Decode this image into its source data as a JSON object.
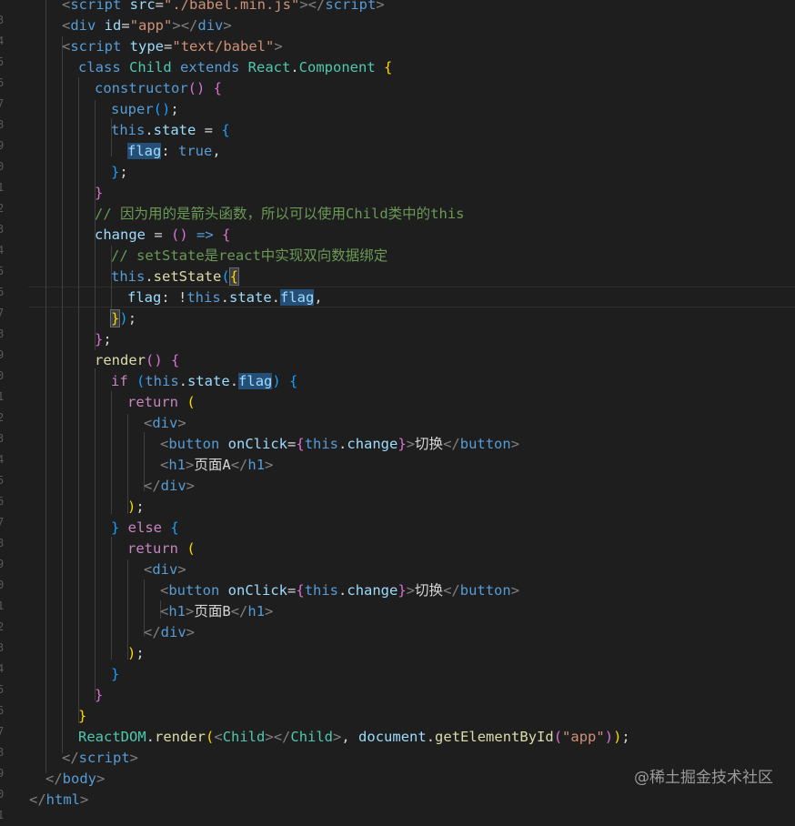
{
  "editor": {
    "gutter_fragments": [
      "3",
      "4",
      "5",
      "6",
      "7",
      "8",
      "9",
      "0",
      "1",
      "2",
      "3",
      "4",
      "5",
      "6",
      "7",
      "8",
      "9",
      "0",
      "1",
      "2",
      "3",
      "4",
      "5",
      "6",
      "7",
      "8",
      "9",
      "0",
      "1",
      "2",
      "3",
      "4",
      "5",
      "6",
      "7",
      "8",
      "9",
      "0",
      "1"
    ],
    "lines": [
      {
        "indent": 68,
        "segs": [
          [
            "tag",
            "<"
          ],
          [
            "tagname",
            "script"
          ],
          [
            "attr",
            " src"
          ],
          [
            "txt",
            "="
          ],
          [
            "str",
            "\"./babel.min.js\""
          ],
          [
            "tag",
            "></"
          ],
          [
            "tagname",
            "script"
          ],
          [
            "tag",
            ">"
          ]
        ]
      },
      {
        "indent": 68,
        "segs": [
          [
            "tag",
            "<"
          ],
          [
            "tagname",
            "div"
          ],
          [
            "attr",
            " id"
          ],
          [
            "txt",
            "="
          ],
          [
            "str",
            "\"app\""
          ],
          [
            "tag",
            "></"
          ],
          [
            "tagname",
            "div"
          ],
          [
            "tag",
            ">"
          ]
        ]
      },
      {
        "indent": 68,
        "segs": [
          [
            "tag",
            "<"
          ],
          [
            "tagname",
            "script"
          ],
          [
            "attr",
            " type"
          ],
          [
            "txt",
            "="
          ],
          [
            "str",
            "\"text/babel\""
          ],
          [
            "tag",
            ">"
          ]
        ]
      },
      {
        "indent": 86,
        "segs": [
          [
            "kw",
            "class "
          ],
          [
            "cls",
            "Child "
          ],
          [
            "kw",
            "extends "
          ],
          [
            "cls",
            "React"
          ],
          [
            "txt",
            "."
          ],
          [
            "cls",
            "Component "
          ],
          [
            "br1",
            "{"
          ]
        ]
      },
      {
        "indent": 104,
        "segs": [
          [
            "kw",
            "constructor"
          ],
          [
            "br2",
            "()"
          ],
          [
            "txt",
            " "
          ],
          [
            "br2",
            "{"
          ]
        ]
      },
      {
        "indent": 122,
        "segs": [
          [
            "kw",
            "super"
          ],
          [
            "br3",
            "()"
          ],
          [
            "txt",
            ";"
          ]
        ]
      },
      {
        "indent": 122,
        "segs": [
          [
            "kw",
            "this"
          ],
          [
            "txt",
            "."
          ],
          [
            "prop",
            "state"
          ],
          [
            "txt",
            " = "
          ],
          [
            "br3",
            "{"
          ]
        ]
      },
      {
        "indent": 140,
        "segs": [
          [
            "hl:prop",
            "flag"
          ],
          [
            "txt",
            ": "
          ],
          [
            "kw",
            "true"
          ],
          [
            "txt",
            ","
          ]
        ]
      },
      {
        "indent": 122,
        "segs": [
          [
            "br3",
            "}"
          ],
          [
            "txt",
            ";"
          ]
        ]
      },
      {
        "indent": 104,
        "segs": [
          [
            "br2",
            "}"
          ]
        ]
      },
      {
        "indent": 104,
        "segs": [
          [
            "cmt",
            "// 因为用的是箭头函数，所以可以使用Child类中的this"
          ]
        ]
      },
      {
        "indent": 104,
        "segs": [
          [
            "var",
            "change"
          ],
          [
            "txt",
            " = "
          ],
          [
            "br2",
            "()"
          ],
          [
            "txt",
            " "
          ],
          [
            "kw",
            "=>"
          ],
          [
            "txt",
            " "
          ],
          [
            "br2",
            "{"
          ]
        ]
      },
      {
        "indent": 122,
        "segs": [
          [
            "cmt",
            "// setState是react中实现双向数据绑定"
          ]
        ]
      },
      {
        "indent": 122,
        "segs": [
          [
            "kw",
            "this"
          ],
          [
            "txt",
            "."
          ],
          [
            "fn",
            "setState"
          ],
          [
            "br3",
            "("
          ],
          [
            "hl2:br1",
            "{"
          ]
        ]
      },
      {
        "indent": 140,
        "segs": [
          [
            "prop",
            "flag"
          ],
          [
            "txt",
            ": !"
          ],
          [
            "kw",
            "this"
          ],
          [
            "txt",
            "."
          ],
          [
            "prop",
            "state"
          ],
          [
            "txt",
            "."
          ],
          [
            "hl:prop",
            "flag"
          ],
          [
            "txt",
            ","
          ]
        ]
      },
      {
        "indent": 122,
        "segs": [
          [
            "hl2:br1",
            "}"
          ],
          [
            "br3",
            ")"
          ],
          [
            "txt",
            ";"
          ]
        ]
      },
      {
        "indent": 104,
        "segs": [
          [
            "br2",
            "}"
          ],
          [
            "txt",
            ";"
          ]
        ]
      },
      {
        "indent": 104,
        "segs": [
          [
            "fn",
            "render"
          ],
          [
            "br2",
            "()"
          ],
          [
            "txt",
            " "
          ],
          [
            "br2",
            "{"
          ]
        ]
      },
      {
        "indent": 122,
        "segs": [
          [
            "ctrl",
            "if "
          ],
          [
            "br3",
            "("
          ],
          [
            "kw",
            "this"
          ],
          [
            "txt",
            "."
          ],
          [
            "prop",
            "state"
          ],
          [
            "txt",
            "."
          ],
          [
            "hl:prop",
            "flag"
          ],
          [
            "br3",
            ")"
          ],
          [
            "txt",
            " "
          ],
          [
            "br3",
            "{"
          ]
        ]
      },
      {
        "indent": 140,
        "segs": [
          [
            "ctrl",
            "return "
          ],
          [
            "br1",
            "("
          ]
        ]
      },
      {
        "indent": 158,
        "segs": [
          [
            "tag",
            "<"
          ],
          [
            "tagname",
            "div"
          ],
          [
            "tag",
            ">"
          ]
        ]
      },
      {
        "indent": 176,
        "segs": [
          [
            "tag",
            "<"
          ],
          [
            "tagname",
            "button"
          ],
          [
            "attr",
            " onClick"
          ],
          [
            "txt",
            "="
          ],
          [
            "br2",
            "{"
          ],
          [
            "kw",
            "this"
          ],
          [
            "txt",
            "."
          ],
          [
            "prop",
            "change"
          ],
          [
            "br2",
            "}"
          ],
          [
            "tag",
            ">"
          ],
          [
            "txt",
            "切换"
          ],
          [
            "tag",
            "</"
          ],
          [
            "tagname",
            "button"
          ],
          [
            "tag",
            ">"
          ]
        ]
      },
      {
        "indent": 176,
        "segs": [
          [
            "tag",
            "<"
          ],
          [
            "tagname",
            "h1"
          ],
          [
            "tag",
            ">"
          ],
          [
            "txt",
            "页面A"
          ],
          [
            "tag",
            "</"
          ],
          [
            "tagname",
            "h1"
          ],
          [
            "tag",
            ">"
          ]
        ]
      },
      {
        "indent": 158,
        "segs": [
          [
            "tag",
            "</"
          ],
          [
            "tagname",
            "div"
          ],
          [
            "tag",
            ">"
          ]
        ]
      },
      {
        "indent": 140,
        "segs": [
          [
            "br1",
            ")"
          ],
          [
            "txt",
            ";"
          ]
        ]
      },
      {
        "indent": 122,
        "segs": [
          [
            "br3",
            "}"
          ],
          [
            "ctrl",
            " else "
          ],
          [
            "br3",
            "{"
          ]
        ]
      },
      {
        "indent": 140,
        "segs": [
          [
            "ctrl",
            "return "
          ],
          [
            "br1",
            "("
          ]
        ]
      },
      {
        "indent": 158,
        "segs": [
          [
            "tag",
            "<"
          ],
          [
            "tagname",
            "div"
          ],
          [
            "tag",
            ">"
          ]
        ]
      },
      {
        "indent": 176,
        "segs": [
          [
            "tag",
            "<"
          ],
          [
            "tagname",
            "button"
          ],
          [
            "attr",
            " onClick"
          ],
          [
            "txt",
            "="
          ],
          [
            "br2",
            "{"
          ],
          [
            "kw",
            "this"
          ],
          [
            "txt",
            "."
          ],
          [
            "prop",
            "change"
          ],
          [
            "br2",
            "}"
          ],
          [
            "tag",
            ">"
          ],
          [
            "txt",
            "切换"
          ],
          [
            "tag",
            "</"
          ],
          [
            "tagname",
            "button"
          ],
          [
            "tag",
            ">"
          ]
        ]
      },
      {
        "indent": 176,
        "segs": [
          [
            "tag",
            "<"
          ],
          [
            "tagname",
            "h1"
          ],
          [
            "tag",
            ">"
          ],
          [
            "txt",
            "页面B"
          ],
          [
            "tag",
            "</"
          ],
          [
            "tagname",
            "h1"
          ],
          [
            "tag",
            ">"
          ]
        ]
      },
      {
        "indent": 158,
        "segs": [
          [
            "tag",
            "</"
          ],
          [
            "tagname",
            "div"
          ],
          [
            "tag",
            ">"
          ]
        ]
      },
      {
        "indent": 140,
        "segs": [
          [
            "br1",
            ")"
          ],
          [
            "txt",
            ";"
          ]
        ]
      },
      {
        "indent": 122,
        "segs": [
          [
            "br3",
            "}"
          ]
        ]
      },
      {
        "indent": 104,
        "segs": [
          [
            "br2",
            "}"
          ]
        ]
      },
      {
        "indent": 86,
        "segs": [
          [
            "br1",
            "}"
          ]
        ]
      },
      {
        "indent": 86,
        "segs": [
          [
            "cls",
            "ReactDOM"
          ],
          [
            "txt",
            "."
          ],
          [
            "fn",
            "render"
          ],
          [
            "br1",
            "("
          ],
          [
            "tag",
            "<"
          ],
          [
            "cls",
            "Child"
          ],
          [
            "tag",
            "></"
          ],
          [
            "cls",
            "Child"
          ],
          [
            "tag",
            ">"
          ],
          [
            "txt",
            ", "
          ],
          [
            "var",
            "document"
          ],
          [
            "txt",
            "."
          ],
          [
            "fn",
            "getElementById"
          ],
          [
            "br2",
            "("
          ],
          [
            "str",
            "\"app\""
          ],
          [
            "br2",
            ")"
          ],
          [
            "br1",
            ")"
          ],
          [
            "txt",
            ";"
          ]
        ]
      },
      {
        "indent": 68,
        "segs": [
          [
            "tag",
            "</"
          ],
          [
            "tagname",
            "script"
          ],
          [
            "tag",
            ">"
          ]
        ]
      },
      {
        "indent": 50,
        "segs": [
          [
            "tag",
            "</"
          ],
          [
            "tagname",
            "body"
          ],
          [
            "tag",
            ">"
          ]
        ]
      },
      {
        "indent": 32,
        "segs": [
          [
            "tag",
            "</"
          ],
          [
            "tagname",
            "html"
          ],
          [
            "tag",
            ">"
          ]
        ]
      }
    ]
  },
  "watermark": "@稀土掘金技术社区"
}
